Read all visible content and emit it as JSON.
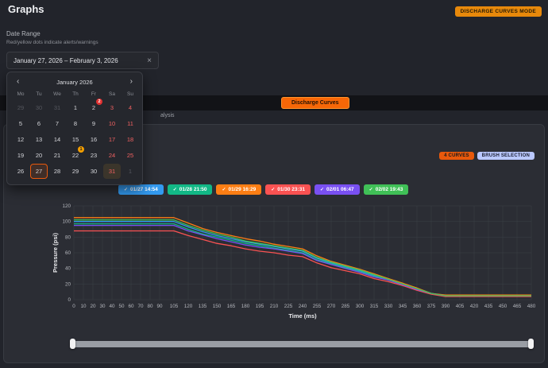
{
  "page": {
    "title": "Graphs",
    "mode_badge": "DISCHARGE CURVES MODE"
  },
  "date_range": {
    "label": "Date Range",
    "hint": "Red/yellow dots indicate alerts/warnings",
    "value": "January 27, 2026 – February 3, 2026",
    "clear_icon": "×"
  },
  "tabs": {
    "discharge_curves": "Discharge Curves",
    "subtitle_fragment": "alysis"
  },
  "toolbar": {
    "curves_badge": "4 CURVES",
    "brush_badge": "BRUSH SELECTION"
  },
  "legend": {
    "check": "✓"
  },
  "calendar": {
    "month": "January 2026",
    "prev_icon": "‹",
    "next_icon": "›",
    "weekdays": [
      "Mo",
      "Tu",
      "We",
      "Th",
      "Fr",
      "Sa",
      "Su"
    ],
    "days": [
      {
        "d": "29",
        "muted": true
      },
      {
        "d": "30",
        "muted": true
      },
      {
        "d": "31",
        "muted": true
      },
      {
        "d": "1"
      },
      {
        "d": "2",
        "badge": "2",
        "badge_type": "red"
      },
      {
        "d": "3",
        "red": true
      },
      {
        "d": "4",
        "red": true
      },
      {
        "d": "5"
      },
      {
        "d": "6"
      },
      {
        "d": "7"
      },
      {
        "d": "8"
      },
      {
        "d": "9"
      },
      {
        "d": "10",
        "red": true
      },
      {
        "d": "11",
        "red": true
      },
      {
        "d": "12"
      },
      {
        "d": "13"
      },
      {
        "d": "14"
      },
      {
        "d": "15"
      },
      {
        "d": "16"
      },
      {
        "d": "17",
        "red": true
      },
      {
        "d": "18",
        "red": true
      },
      {
        "d": "19"
      },
      {
        "d": "20"
      },
      {
        "d": "21"
      },
      {
        "d": "22",
        "badge": "1",
        "badge_type": "orange"
      },
      {
        "d": "23"
      },
      {
        "d": "24",
        "red": true
      },
      {
        "d": "25",
        "red": true
      },
      {
        "d": "26"
      },
      {
        "d": "27",
        "selected": true
      },
      {
        "d": "28"
      },
      {
        "d": "29"
      },
      {
        "d": "30"
      },
      {
        "d": "31",
        "red": true,
        "inrange": true
      },
      {
        "d": "1",
        "muted": true
      }
    ]
  },
  "chart_data": {
    "type": "line",
    "xlabel": "Time (ms)",
    "ylabel": "Pressure (psi)",
    "xlim": [
      0,
      480
    ],
    "ylim": [
      0,
      120
    ],
    "grid": true,
    "legend_position": "top",
    "yticks": [
      0,
      20,
      40,
      60,
      80,
      100,
      120
    ],
    "xticks": [
      0,
      10,
      20,
      30,
      40,
      50,
      60,
      70,
      80,
      90,
      105,
      120,
      135,
      150,
      165,
      180,
      195,
      210,
      225,
      240,
      255,
      270,
      285,
      300,
      315,
      330,
      345,
      360,
      375,
      390,
      405,
      420,
      435,
      450,
      465,
      480
    ],
    "x": [
      0,
      15,
      30,
      45,
      60,
      75,
      90,
      105,
      120,
      135,
      150,
      165,
      180,
      195,
      210,
      225,
      240,
      255,
      270,
      285,
      300,
      315,
      330,
      345,
      360,
      375,
      390,
      405,
      420,
      435,
      450,
      465,
      480
    ],
    "series": [
      {
        "name": "01/27 14:54",
        "color": "#339af0",
        "values": [
          100,
          100,
          100,
          100,
          100,
          100,
          100,
          100,
          93,
          87,
          82,
          78,
          74,
          71,
          68,
          65,
          62,
          53,
          47,
          42,
          37,
          31,
          26,
          20,
          14,
          8,
          5,
          5,
          5,
          5,
          5,
          5,
          5
        ]
      },
      {
        "name": "01/28 21:50",
        "color": "#12b886",
        "values": [
          97,
          97,
          97,
          97,
          97,
          97,
          97,
          97,
          90,
          84,
          80,
          76,
          72,
          69,
          66,
          63,
          60,
          51,
          46,
          41,
          36,
          30,
          25,
          19,
          14,
          8,
          5,
          5,
          5,
          5,
          5,
          5,
          5
        ]
      },
      {
        "name": "01/29 16:29",
        "color": "#fd7e14",
        "values": [
          105,
          105,
          105,
          105,
          105,
          105,
          105,
          105,
          98,
          91,
          86,
          82,
          78,
          75,
          71,
          68,
          65,
          56,
          49,
          44,
          39,
          33,
          27,
          21,
          15,
          8,
          6,
          6,
          6,
          6,
          6,
          6,
          6
        ]
      },
      {
        "name": "01/30 23:31",
        "color": "#fa5252",
        "values": [
          88,
          88,
          88,
          88,
          88,
          88,
          88,
          88,
          82,
          77,
          72,
          69,
          65,
          62,
          60,
          57,
          55,
          47,
          41,
          37,
          33,
          27,
          23,
          18,
          12,
          7,
          4,
          4,
          4,
          4,
          4,
          4,
          4
        ]
      },
      {
        "name": "02/01 06:47",
        "color": "#7950f2",
        "values": [
          95,
          95,
          95,
          95,
          95,
          95,
          95,
          95,
          88,
          83,
          78,
          74,
          70,
          67,
          65,
          62,
          59,
          50,
          45,
          40,
          35,
          29,
          25,
          19,
          13,
          8,
          5,
          5,
          5,
          5,
          5,
          5,
          5
        ]
      },
      {
        "name": "02/02 19:43",
        "color": "#40c057",
        "values": [
          102,
          102,
          102,
          102,
          102,
          102,
          102,
          102,
          95,
          89,
          84,
          80,
          75,
          72,
          69,
          66,
          63,
          54,
          48,
          43,
          38,
          32,
          26,
          20,
          14,
          8,
          5,
          5,
          5,
          5,
          5,
          5,
          5
        ]
      }
    ]
  }
}
